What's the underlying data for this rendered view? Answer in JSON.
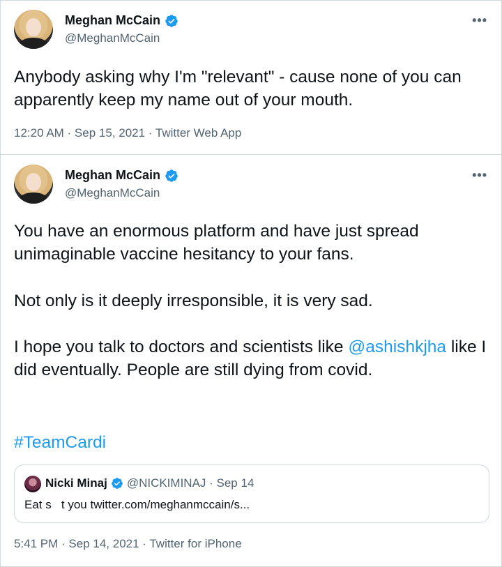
{
  "tweets": [
    {
      "name": "Meghan McCain",
      "handle": "@MeghanMcCain",
      "more": "•••",
      "text": "Anybody asking why I'm \"relevant\" - cause none of you can apparently keep my name out of your mouth.",
      "meta": "12:20 AM · Sep 15, 2021 · Twitter Web App"
    },
    {
      "name": "Meghan McCain",
      "handle": "@MeghanMcCain",
      "more": "•••",
      "para1": "You have an enormous platform and have just spread unimaginable vaccine hesitancy to your fans.",
      "para2": "Not only is it deeply irresponsible, it is very sad.",
      "para3_pre": "I hope you talk to doctors and scientists like ",
      "para3_mention": "@ashishkjha",
      "para3_post": " like I did eventually. People are still dying from covid.",
      "hashtag": "#TeamCardi",
      "quote": {
        "name": "Nicki Minaj",
        "handle_date": "@NICKIMINAJ · Sep 14",
        "text": "Eat s   t you twitter.com/meghanmccain/s..."
      },
      "meta": "5:41 PM · Sep 14, 2021 · Twitter for iPhone"
    }
  ],
  "colors": {
    "link": "#1d9bf0",
    "muted": "#536471",
    "border": "#cfd9de",
    "verified": "#1d9bf0"
  }
}
